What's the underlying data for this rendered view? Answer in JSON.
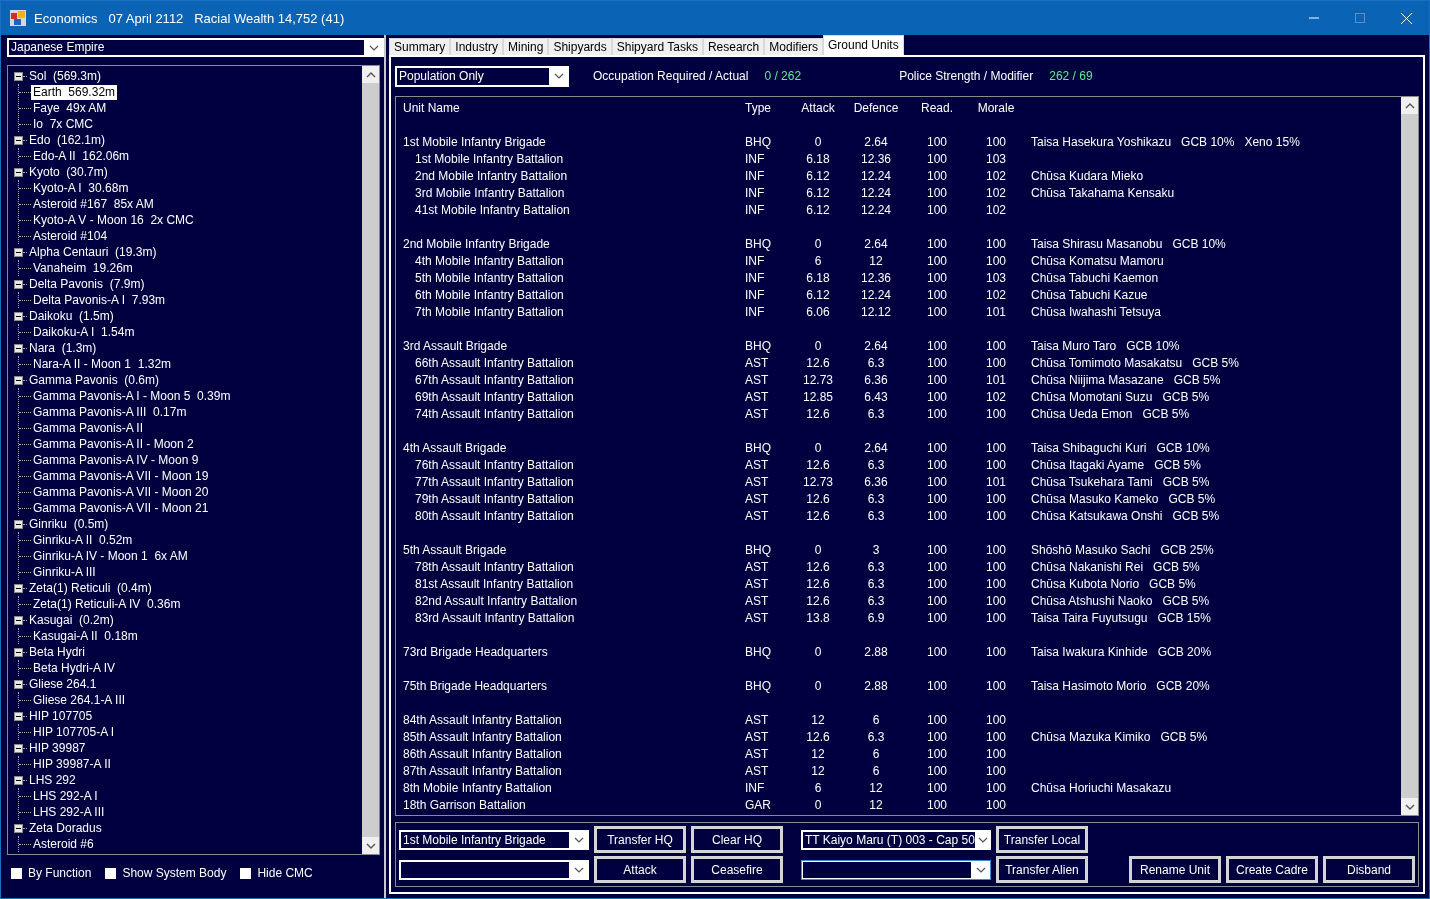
{
  "window": {
    "title": "Economics   07 April 2112   Racial Wealth 14,752 (41)",
    "maximize_disabled": true
  },
  "race_selector": {
    "value": "Japanese Empire"
  },
  "tree": [
    {
      "label": "Sol  (569.3m)",
      "expanded": true,
      "children": [
        {
          "label": "Earth  569.32m",
          "selected": true
        },
        {
          "label": "Faye  49x AM",
          "selected": false
        },
        {
          "label": "Io  7x CMC",
          "selected": false
        }
      ]
    },
    {
      "label": "Edo  (162.1m)",
      "expanded": true,
      "children": [
        {
          "label": "Edo-A II  162.06m",
          "selected": false
        }
      ]
    },
    {
      "label": "Kyoto  (30.7m)",
      "expanded": true,
      "children": [
        {
          "label": "Kyoto-A I  30.68m",
          "selected": false
        },
        {
          "label": "Asteroid #167  85x AM",
          "selected": false
        },
        {
          "label": "Kyoto-A V - Moon 16  2x CMC",
          "selected": false
        },
        {
          "label": "Asteroid #104",
          "selected": false
        }
      ]
    },
    {
      "label": "Alpha Centauri  (19.3m)",
      "expanded": true,
      "children": [
        {
          "label": "Vanaheim  19.26m",
          "selected": false
        }
      ]
    },
    {
      "label": "Delta Pavonis  (7.9m)",
      "expanded": true,
      "children": [
        {
          "label": "Delta Pavonis-A I  7.93m",
          "selected": false
        }
      ]
    },
    {
      "label": "Daikoku  (1.5m)",
      "expanded": true,
      "children": [
        {
          "label": "Daikoku-A I  1.54m",
          "selected": false
        }
      ]
    },
    {
      "label": "Nara  (1.3m)",
      "expanded": true,
      "children": [
        {
          "label": "Nara-A II - Moon 1  1.32m",
          "selected": false
        }
      ]
    },
    {
      "label": "Gamma Pavonis  (0.6m)",
      "expanded": true,
      "children": [
        {
          "label": "Gamma Pavonis-A I - Moon 5  0.39m",
          "selected": false
        },
        {
          "label": "Gamma Pavonis-A III  0.17m",
          "selected": false
        },
        {
          "label": "Gamma Pavonis-A II",
          "selected": false
        },
        {
          "label": "Gamma Pavonis-A II - Moon 2",
          "selected": false
        },
        {
          "label": "Gamma Pavonis-A IV - Moon 9",
          "selected": false
        },
        {
          "label": "Gamma Pavonis-A VII - Moon 19",
          "selected": false
        },
        {
          "label": "Gamma Pavonis-A VII - Moon 20",
          "selected": false
        },
        {
          "label": "Gamma Pavonis-A VII - Moon 21",
          "selected": false
        }
      ]
    },
    {
      "label": "Ginriku  (0.5m)",
      "expanded": true,
      "children": [
        {
          "label": "Ginriku-A II  0.52m",
          "selected": false
        },
        {
          "label": "Ginriku-A IV - Moon 1  6x AM",
          "selected": false
        },
        {
          "label": "Ginriku-A III",
          "selected": false
        }
      ]
    },
    {
      "label": "Zeta(1) Reticuli  (0.4m)",
      "expanded": true,
      "children": [
        {
          "label": "Zeta(1) Reticuli-A IV  0.36m",
          "selected": false
        }
      ]
    },
    {
      "label": "Kasugai  (0.2m)",
      "expanded": true,
      "children": [
        {
          "label": "Kasugai-A II  0.18m",
          "selected": false
        }
      ]
    },
    {
      "label": "Beta Hydri",
      "expanded": true,
      "children": [
        {
          "label": "Beta Hydri-A IV",
          "selected": false
        }
      ]
    },
    {
      "label": "Gliese 264.1",
      "expanded": true,
      "children": [
        {
          "label": "Gliese 264.1-A III",
          "selected": false
        }
      ]
    },
    {
      "label": "HIP 107705",
      "expanded": true,
      "children": [
        {
          "label": "HIP 107705-A I",
          "selected": false
        }
      ]
    },
    {
      "label": "HIP 39987",
      "expanded": true,
      "children": [
        {
          "label": "HIP 39987-A II",
          "selected": false
        }
      ]
    },
    {
      "label": "LHS 292",
      "expanded": true,
      "children": [
        {
          "label": "LHS 292-A I",
          "selected": false
        },
        {
          "label": "LHS 292-A III",
          "selected": false
        }
      ]
    },
    {
      "label": "Zeta Doradus",
      "expanded": true,
      "children": [
        {
          "label": "Asteroid #6",
          "selected": false
        }
      ]
    }
  ],
  "options": [
    {
      "label": "By Function",
      "checked": false
    },
    {
      "label": "Show System Body",
      "checked": false
    },
    {
      "label": "Hide CMC",
      "checked": false
    }
  ],
  "tabs": [
    {
      "label": "Summary",
      "selected": false
    },
    {
      "label": "Industry",
      "selected": false
    },
    {
      "label": "Mining",
      "selected": false
    },
    {
      "label": "Shipyards",
      "selected": false
    },
    {
      "label": "Shipyard Tasks",
      "selected": false
    },
    {
      "label": "Research",
      "selected": false
    },
    {
      "label": "Modifiers",
      "selected": false
    },
    {
      "label": "Ground Units",
      "selected": true
    }
  ],
  "filter": {
    "value": "Population Only"
  },
  "stats": [
    {
      "label": "Occupation Required / Actual",
      "value": "0 / 262"
    },
    {
      "label": "Police Strength / Modifier",
      "value": "262 / 69"
    }
  ],
  "table": {
    "columns": [
      "Unit Name",
      "Type",
      "Attack",
      "Defence",
      "Read.",
      "Morale"
    ],
    "groups": [
      [
        {
          "name": "1st Mobile Infantry Brigade",
          "type": "BHQ",
          "attack": "0",
          "defence": "2.64",
          "read": "100",
          "morale": "100",
          "column_7": "Taisa Hasekura Yoshikazu   GCB 10%   Xeno 15%",
          "children": [
            {
              "name": "1st Mobile Infantry Battalion",
              "type": "INF",
              "attack": "6.18",
              "defence": "12.36",
              "read": "100",
              "morale": "103"
            },
            {
              "name": "2nd Mobile Infantry Battalion",
              "type": "INF",
              "attack": "6.12",
              "defence": "12.24",
              "read": "100",
              "morale": "102",
              "column_7": "Chūsa Kudara Mieko"
            },
            {
              "name": "3rd Mobile Infantry Battalion",
              "type": "INF",
              "attack": "6.12",
              "defence": "12.24",
              "read": "100",
              "morale": "102",
              "column_7": "Chūsa Takahama Kensaku"
            },
            {
              "name": "41st Mobile Infantry Battalion",
              "type": "INF",
              "attack": "6.12",
              "defence": "12.24",
              "read": "100",
              "morale": "102"
            }
          ]
        }
      ],
      [
        {
          "name": "2nd Mobile Infantry Brigade",
          "type": "BHQ",
          "attack": "0",
          "defence": "2.64",
          "read": "100",
          "morale": "100",
          "column_7": "Taisa Shirasu Masanobu   GCB 10%",
          "children": [
            {
              "name": "4th Mobile Infantry Battalion",
              "type": "INF",
              "attack": "6",
              "defence": "12",
              "read": "100",
              "morale": "100",
              "column_7": "Chūsa Komatsu Mamoru"
            },
            {
              "name": "5th Mobile Infantry Battalion",
              "type": "INF",
              "attack": "6.18",
              "defence": "12.36",
              "read": "100",
              "morale": "103",
              "column_7": "Chūsa Tabuchi Kaemon"
            },
            {
              "name": "6th Mobile Infantry Battalion",
              "type": "INF",
              "attack": "6.12",
              "defence": "12.24",
              "read": "100",
              "morale": "102",
              "column_7": "Chūsa Tabuchi Kazue"
            },
            {
              "name": "7th Mobile Infantry Battalion",
              "type": "INF",
              "attack": "6.06",
              "defence": "12.12",
              "read": "100",
              "morale": "101",
              "column_7": "Chūsa Iwahashi Tetsuya"
            }
          ]
        }
      ],
      [
        {
          "name": "3rd Assault Brigade",
          "type": "BHQ",
          "attack": "0",
          "defence": "2.64",
          "read": "100",
          "morale": "100",
          "column_7": "Taisa Muro Taro   GCB 10%",
          "children": [
            {
              "name": "66th Assault Infantry Battalion",
              "type": "AST",
              "attack": "12.6",
              "defence": "6.3",
              "read": "100",
              "morale": "100",
              "column_7": "Chūsa Tomimoto Masakatsu   GCB 5%"
            },
            {
              "name": "67th Assault Infantry Battalion",
              "type": "AST",
              "attack": "12.73",
              "defence": "6.36",
              "read": "100",
              "morale": "101",
              "column_7": "Chūsa Niijima Masazane   GCB 5%"
            },
            {
              "name": "69th Assault Infantry Battalion",
              "type": "AST",
              "attack": "12.85",
              "defence": "6.43",
              "read": "100",
              "morale": "102",
              "column_7": "Chūsa Momotani Suzu   GCB 5%"
            },
            {
              "name": "74th Assault Infantry Battalion",
              "type": "AST",
              "attack": "12.6",
              "defence": "6.3",
              "read": "100",
              "morale": "100",
              "column_7": "Chūsa Ueda Emon   GCB 5%"
            }
          ]
        }
      ],
      [
        {
          "name": "4th Assault Brigade",
          "type": "BHQ",
          "attack": "0",
          "defence": "2.64",
          "read": "100",
          "morale": "100",
          "column_7": "Taisa Shibaguchi Kuri   GCB 10%",
          "children": [
            {
              "name": "76th Assault Infantry Battalion",
              "type": "AST",
              "attack": "12.6",
              "defence": "6.3",
              "read": "100",
              "morale": "100",
              "column_7": "Chūsa Itagaki Ayame   GCB 5%"
            },
            {
              "name": "77th Assault Infantry Battalion",
              "type": "AST",
              "attack": "12.73",
              "defence": "6.36",
              "read": "100",
              "morale": "101",
              "column_7": "Chūsa Tsukehara Tami   GCB 5%"
            },
            {
              "name": "79th Assault Infantry Battalion",
              "type": "AST",
              "attack": "12.6",
              "defence": "6.3",
              "read": "100",
              "morale": "100",
              "column_7": "Chūsa Masuko Kameko   GCB 5%"
            },
            {
              "name": "80th Assault Infantry Battalion",
              "type": "AST",
              "attack": "12.6",
              "defence": "6.3",
              "read": "100",
              "morale": "100",
              "column_7": "Chūsa Katsukawa Onshi   GCB 5%"
            }
          ]
        }
      ],
      [
        {
          "name": "5th Assault Brigade",
          "type": "BHQ",
          "attack": "0",
          "defence": "3",
          "read": "100",
          "morale": "100",
          "column_7": "Shōshō Masuko Sachi   GCB 25%",
          "children": [
            {
              "name": "78th Assault Infantry Battalion",
              "type": "AST",
              "attack": "12.6",
              "defence": "6.3",
              "read": "100",
              "morale": "100",
              "column_7": "Chūsa Nakanishi Rei   GCB 5%"
            },
            {
              "name": "81st Assault Infantry Battalion",
              "type": "AST",
              "attack": "12.6",
              "defence": "6.3",
              "read": "100",
              "morale": "100",
              "column_7": "Chūsa Kubota Norio   GCB 5%"
            },
            {
              "name": "82nd Assault Infantry Battalion",
              "type": "AST",
              "attack": "12.6",
              "defence": "6.3",
              "read": "100",
              "morale": "100",
              "column_7": "Chūsa Atshushi Naoko   GCB 5%"
            },
            {
              "name": "83rd Assault Infantry Battalion",
              "type": "AST",
              "attack": "13.8",
              "defence": "6.9",
              "read": "100",
              "morale": "100",
              "column_7": "Taisa Taira Fuyutsugu   GCB 15%"
            }
          ]
        }
      ],
      [
        {
          "name": "73rd Brigade Headquarters",
          "type": "BHQ",
          "attack": "0",
          "defence": "2.88",
          "read": "100",
          "morale": "100",
          "column_7": "Taisa Iwakura Kinhide   GCB 20%"
        }
      ],
      [
        {
          "name": "75th Brigade Headquarters",
          "type": "BHQ",
          "attack": "0",
          "defence": "2.88",
          "read": "100",
          "morale": "100",
          "column_7": "Taisa Hasimoto Morio   GCB 20%"
        }
      ],
      [
        {
          "name": "84th Assault Infantry Battalion",
          "type": "AST",
          "attack": "12",
          "defence": "6",
          "read": "100",
          "morale": "100"
        },
        {
          "name": "85th Assault Infantry Battalion",
          "type": "AST",
          "attack": "12.6",
          "defence": "6.3",
          "read": "100",
          "morale": "100",
          "column_7": "Chūsa Mazuka Kimiko   GCB 5%"
        },
        {
          "name": "86th Assault Infantry Battalion",
          "type": "AST",
          "attack": "12",
          "defence": "6",
          "read": "100",
          "morale": "100"
        },
        {
          "name": "87th Assault Infantry Battalion",
          "type": "AST",
          "attack": "12",
          "defence": "6",
          "read": "100",
          "morale": "100"
        },
        {
          "name": "8th Mobile Infantry Battalion",
          "type": "INF",
          "attack": "6",
          "defence": "12",
          "read": "100",
          "morale": "100",
          "column_7": "Chūsa Horiuchi Masakazu"
        },
        {
          "name": "18th Garrison Battalion",
          "type": "GAR",
          "attack": "0",
          "defence": "12",
          "read": "100",
          "morale": "100"
        }
      ]
    ]
  },
  "controls": [
    [
      {
        "kind": "combo",
        "value": "1st Mobile Infantry Brigade",
        "focused": false
      },
      {
        "kind": "button",
        "label": "Transfer HQ"
      },
      {
        "kind": "button",
        "label": "Clear HQ"
      },
      {
        "kind": "combo",
        "value": "TT Kaiyo Maru (T) 003 - Cap 50",
        "focused": false
      },
      {
        "kind": "button",
        "label": "Transfer Local"
      }
    ],
    [
      {
        "kind": "combo",
        "focused": false
      },
      {
        "kind": "button",
        "label": "Attack"
      },
      {
        "kind": "button",
        "label": "Ceasefire"
      },
      {
        "kind": "combo",
        "focused": true
      },
      {
        "kind": "button",
        "label": "Transfer Alien"
      },
      {
        "kind": "spacer"
      },
      {
        "kind": "button",
        "label": "Rename Unit"
      },
      {
        "kind": "button",
        "label": "Create Cadre"
      },
      {
        "kind": "button",
        "label": "Disband"
      }
    ]
  ]
}
